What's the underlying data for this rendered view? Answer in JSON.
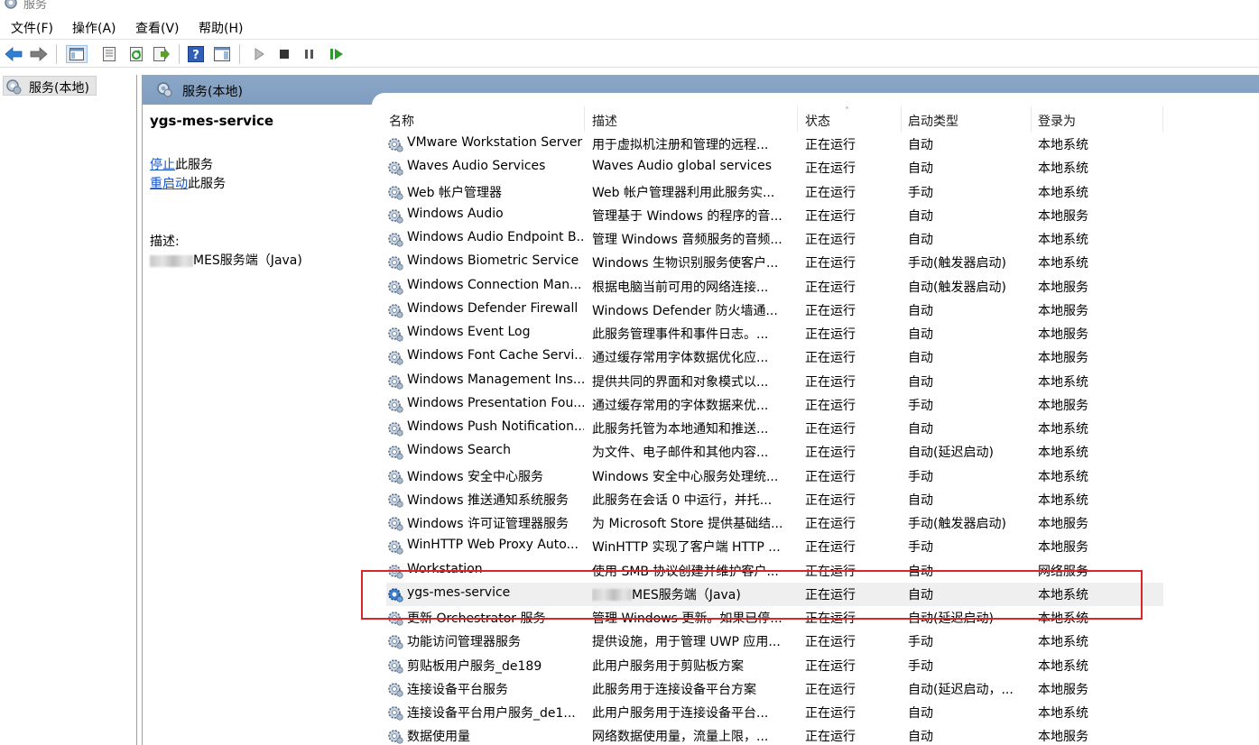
{
  "window": {
    "title": "服务"
  },
  "menu": {
    "items": [
      "文件(F)",
      "操作(A)",
      "查看(V)",
      "帮助(H)"
    ]
  },
  "tree": {
    "root_label": "服务(本地)"
  },
  "panel": {
    "header_title": "服务(本地)"
  },
  "details": {
    "service_name": "ygs-mes-service",
    "stop_link": "停止",
    "stop_suffix": "此服务",
    "restart_link": "重启动",
    "restart_suffix": "此服务",
    "description_label": "描述:",
    "description_text": "MES服务端（Java)"
  },
  "list": {
    "columns": [
      "名称",
      "描述",
      "状态",
      "启动类型",
      "登录为"
    ],
    "selected_index": 19,
    "rows": [
      {
        "name": "VMware Workstation Server",
        "desc": "用于虚拟机注册和管理的远程...",
        "status": "正在运行",
        "startup": "自动",
        "logon": "本地系统"
      },
      {
        "name": "Waves Audio Services",
        "desc": "Waves Audio global services",
        "status": "正在运行",
        "startup": "自动",
        "logon": "本地系统"
      },
      {
        "name": "Web 帐户管理器",
        "desc": "Web 帐户管理器利用此服务实...",
        "status": "正在运行",
        "startup": "手动",
        "logon": "本地系统"
      },
      {
        "name": "Windows Audio",
        "desc": "管理基于 Windows 的程序的音...",
        "status": "正在运行",
        "startup": "自动",
        "logon": "本地服务"
      },
      {
        "name": "Windows Audio Endpoint B...",
        "desc": "管理 Windows 音频服务的音频...",
        "status": "正在运行",
        "startup": "自动",
        "logon": "本地系统"
      },
      {
        "name": "Windows Biometric Service",
        "desc": "Windows 生物识别服务使客户...",
        "status": "正在运行",
        "startup": "手动(触发器启动)",
        "logon": "本地系统"
      },
      {
        "name": "Windows Connection Man...",
        "desc": "根据电脑当前可用的网络连接...",
        "status": "正在运行",
        "startup": "自动(触发器启动)",
        "logon": "本地服务"
      },
      {
        "name": "Windows Defender Firewall",
        "desc": "Windows Defender 防火墙通...",
        "status": "正在运行",
        "startup": "自动",
        "logon": "本地服务"
      },
      {
        "name": "Windows Event Log",
        "desc": "此服务管理事件和事件日志。...",
        "status": "正在运行",
        "startup": "自动",
        "logon": "本地服务"
      },
      {
        "name": "Windows Font Cache Servi...",
        "desc": "通过缓存常用字体数据优化应...",
        "status": "正在运行",
        "startup": "自动",
        "logon": "本地服务"
      },
      {
        "name": "Windows Management Ins...",
        "desc": "提供共同的界面和对象模式以...",
        "status": "正在运行",
        "startup": "自动",
        "logon": "本地系统"
      },
      {
        "name": "Windows Presentation Fou...",
        "desc": "通过缓存常用的字体数据来优...",
        "status": "正在运行",
        "startup": "手动",
        "logon": "本地服务"
      },
      {
        "name": "Windows Push Notification...",
        "desc": "此服务托管为本地通知和推送...",
        "status": "正在运行",
        "startup": "自动",
        "logon": "本地系统"
      },
      {
        "name": "Windows Search",
        "desc": "为文件、电子邮件和其他内容...",
        "status": "正在运行",
        "startup": "自动(延迟启动)",
        "logon": "本地系统"
      },
      {
        "name": "Windows 安全中心服务",
        "desc": "Windows 安全中心服务处理统...",
        "status": "正在运行",
        "startup": "手动",
        "logon": "本地系统"
      },
      {
        "name": "Windows 推送通知系统服务",
        "desc": "此服务在会话 0 中运行，并托...",
        "status": "正在运行",
        "startup": "自动",
        "logon": "本地系统"
      },
      {
        "name": "Windows 许可证管理器服务",
        "desc": "为 Microsoft Store 提供基础结...",
        "status": "正在运行",
        "startup": "手动(触发器启动)",
        "logon": "本地服务"
      },
      {
        "name": "WinHTTP Web Proxy Auto...",
        "desc": "WinHTTP 实现了客户端 HTTP ...",
        "status": "正在运行",
        "startup": "手动",
        "logon": "本地服务"
      },
      {
        "name": "Workstation",
        "desc": "使用 SMB 协议创建并维护客户...",
        "status": "正在运行",
        "startup": "自动",
        "logon": "网络服务"
      },
      {
        "name": "ygs-mes-service",
        "desc": "MES服务端（Java)",
        "status": "正在运行",
        "startup": "自动",
        "logon": "本地系统"
      },
      {
        "name": "更新 Orchestrator 服务",
        "desc": "管理 Windows 更新。如果已停...",
        "status": "正在运行",
        "startup": "自动(延迟启动)",
        "logon": "本地系统"
      },
      {
        "name": "功能访问管理器服务",
        "desc": "提供设施，用于管理 UWP 应用...",
        "status": "正在运行",
        "startup": "手动",
        "logon": "本地系统"
      },
      {
        "name": "剪贴板用户服务_de189",
        "desc": "此用户服务用于剪贴板方案",
        "status": "正在运行",
        "startup": "手动",
        "logon": "本地系统"
      },
      {
        "name": "连接设备平台服务",
        "desc": "此服务用于连接设备平台方案",
        "status": "正在运行",
        "startup": "自动(延迟启动，...",
        "logon": "本地服务"
      },
      {
        "name": "连接设备平台用户服务_de1...",
        "desc": "此用户服务用于连接设备平台...",
        "status": "正在运行",
        "startup": "自动",
        "logon": "本地系统"
      },
      {
        "name": "数据使用量",
        "desc": "网络数据使用量，流量上限，...",
        "status": "正在运行",
        "startup": "自动",
        "logon": "本地服务"
      }
    ]
  },
  "colors": {
    "highlight": "#d9262b",
    "link": "#1a55c4",
    "header": "#8ba7c7"
  },
  "icons": [
    "gear-icon",
    "back-arrow-icon",
    "forward-arrow-icon",
    "play-icon",
    "stop-icon",
    "pause-icon",
    "resume-icon",
    "help-icon"
  ]
}
